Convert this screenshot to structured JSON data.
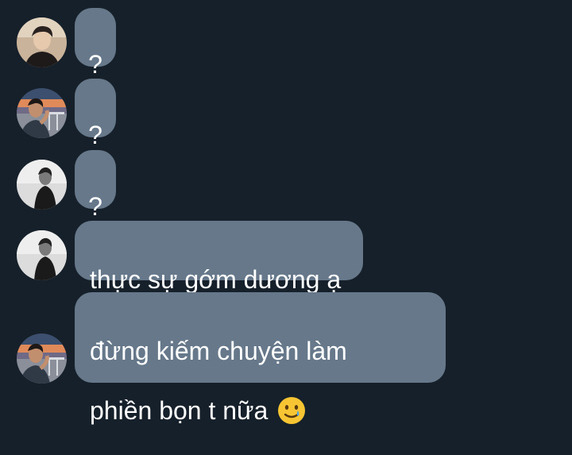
{
  "messages": [
    {
      "avatar": "avatar-photo-dark",
      "text": "?"
    },
    {
      "avatar": "avatar-photo-sunset",
      "text": "?"
    },
    {
      "avatar": "avatar-photo-bw",
      "text": "?"
    },
    {
      "avatar": "avatar-photo-bw",
      "text": "thực sự gớm dương ạ"
    },
    {
      "avatar": "avatar-photo-sunset",
      "line1": "đừng kiếm chuyện làm",
      "line2": "phiền bọn t nữa",
      "emoji": "smiling-face-with-tear-icon"
    }
  ],
  "colors": {
    "background": "#16202a",
    "bubble": "#66788a",
    "text": "#ffffff"
  }
}
